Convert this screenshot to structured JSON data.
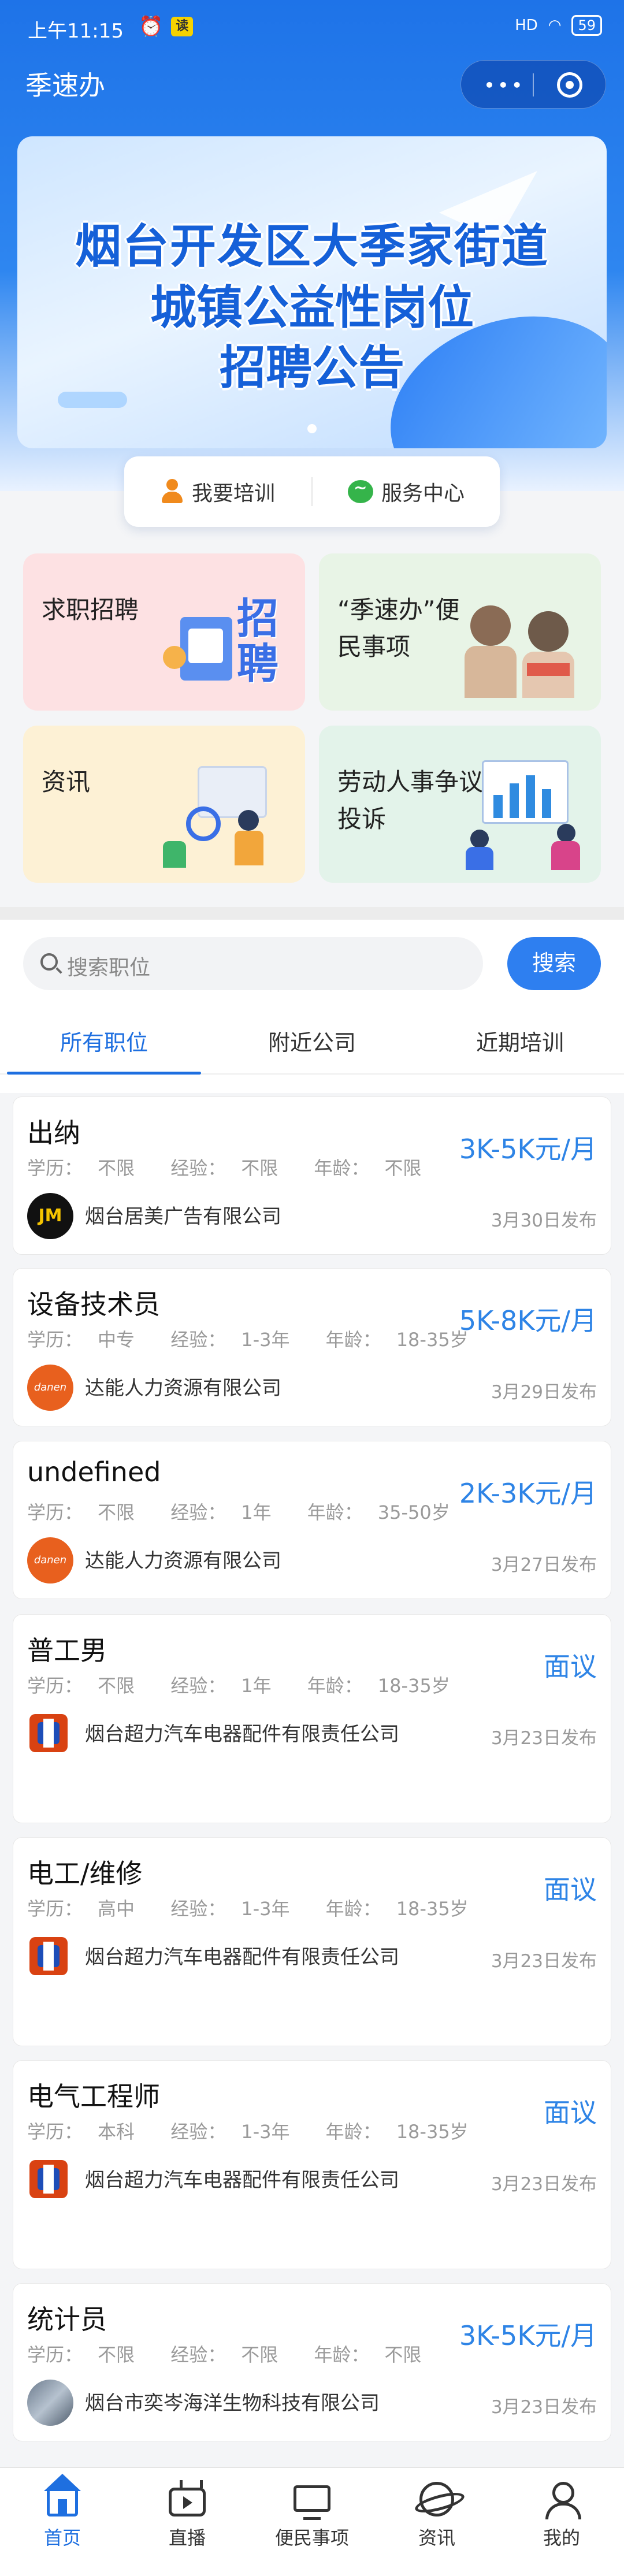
{
  "status_bar": {
    "time": "上午11:15",
    "read_badge": "读",
    "network": "HD",
    "battery": "59"
  },
  "header": {
    "title": "季速办",
    "menu_dots": "•••"
  },
  "banner": {
    "line1": "烟台开发区大季家街道",
    "line2": "城镇公益性岗位",
    "line3": "招聘公告"
  },
  "quick_links": [
    {
      "label": "我要培训",
      "icon": "person-icon"
    },
    {
      "label": "服务中心",
      "icon": "chat-icon"
    }
  ],
  "feature_cards": [
    {
      "label": "求职招聘",
      "illustration_text": "招聘",
      "color": "#fde1e3"
    },
    {
      "label": "“季速办”便民事项",
      "color": "#e8f4e6"
    },
    {
      "label": "资讯",
      "color": "#fdf1d5"
    },
    {
      "label": "劳动人事争议投诉",
      "color": "#e3f3ea"
    }
  ],
  "search": {
    "placeholder": "搜索职位",
    "button": "搜索"
  },
  "tabs": [
    "所有职位",
    "附近公司",
    "近期培训"
  ],
  "job_labels": {
    "edu": "学历：",
    "exp": "经验：",
    "age": "年龄："
  },
  "jobs": [
    {
      "title": "出纳",
      "edu": "不限",
      "exp": "不限",
      "age": "不限",
      "salary": "3K-5K元/月",
      "company": "烟台居美广告有限公司",
      "date": "3月30日发布",
      "logo": "JM"
    },
    {
      "title": "设备技术员",
      "edu": "中专",
      "exp": "1-3年",
      "age": "18-35岁",
      "salary": "5K-8K元/月",
      "company": "达能人力资源有限公司",
      "date": "3月29日发布",
      "logo": "danen"
    },
    {
      "title": "undefined",
      "edu": "不限",
      "exp": "1年",
      "age": "35-50岁",
      "salary": "2K-3K元/月",
      "company": "达能人力资源有限公司",
      "date": "3月27日发布",
      "logo": "danen"
    },
    {
      "title": "普工男",
      "edu": "不限",
      "exp": "1年",
      "age": "18-35岁",
      "salary": "面议",
      "company": "烟台超力汽车电器配件有限责任公司",
      "date": "3月23日发布",
      "logo": ""
    },
    {
      "title": "电工/维修",
      "edu": "高中",
      "exp": "1-3年",
      "age": "18-35岁",
      "salary": "面议",
      "company": "烟台超力汽车电器配件有限责任公司",
      "date": "3月23日发布",
      "logo": ""
    },
    {
      "title": "电气工程师",
      "edu": "本科",
      "exp": "1-3年",
      "age": "18-35岁",
      "salary": "面议",
      "company": "烟台超力汽车电器配件有限责任公司",
      "date": "3月23日发布",
      "logo": ""
    },
    {
      "title": "统计员",
      "edu": "不限",
      "exp": "不限",
      "age": "不限",
      "salary": "3K-5K元/月",
      "company": "烟台市奕岑海洋生物科技有限公司",
      "date": "3月23日发布",
      "logo": ""
    }
  ],
  "tab_bar": [
    {
      "label": "首页",
      "icon": "home-icon",
      "active": true
    },
    {
      "label": "直播",
      "icon": "tv-icon"
    },
    {
      "label": "便民事项",
      "icon": "screen-icon"
    },
    {
      "label": "资讯",
      "icon": "globe-icon"
    },
    {
      "label": "我的",
      "icon": "user-icon"
    }
  ],
  "colors": {
    "primary": "#1e6fe0",
    "salary": "#2e84e6"
  }
}
